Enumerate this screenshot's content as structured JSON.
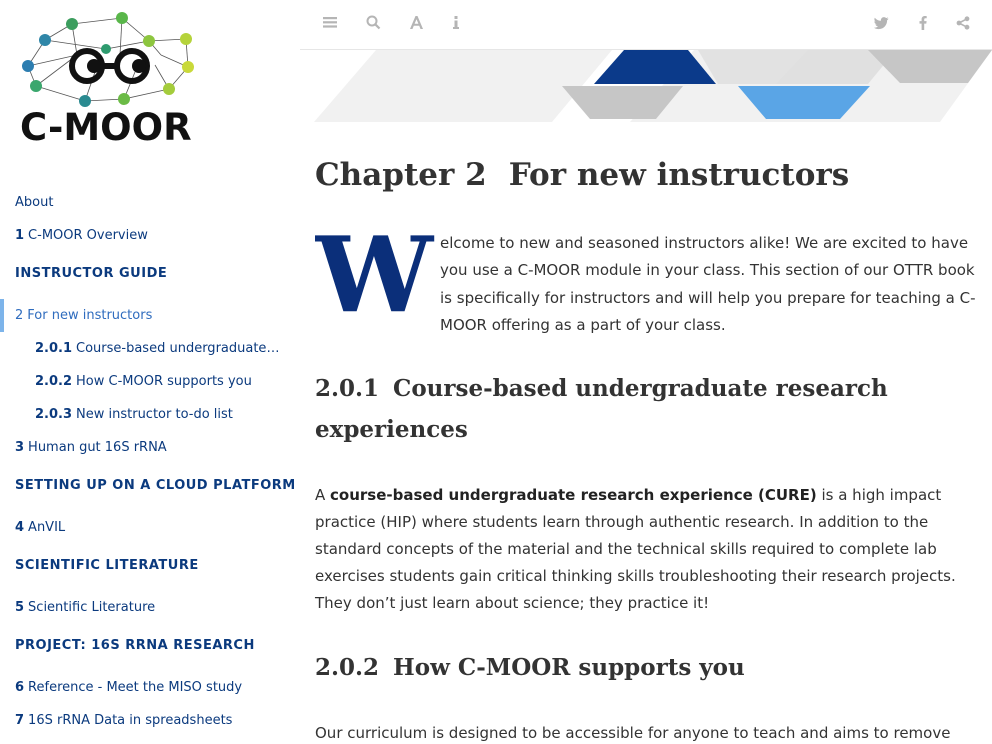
{
  "logo": {
    "text": "C-MOOR"
  },
  "toolbar": {
    "buttons": [
      {
        "name": "toggle-sidebar",
        "icon": "list-icon"
      },
      {
        "name": "search",
        "icon": "search-icon"
      },
      {
        "name": "font-settings",
        "icon": "font-icon"
      },
      {
        "name": "info",
        "icon": "info-icon"
      },
      {
        "name": "twitter",
        "icon": "twitter-icon"
      },
      {
        "name": "facebook",
        "icon": "facebook-icon"
      },
      {
        "name": "share",
        "icon": "share-icon"
      }
    ]
  },
  "sidebar": {
    "about": "About",
    "item1": {
      "num": "1",
      "label": "C-MOOR Overview"
    },
    "header_instructor": "Instructor Guide",
    "item2": {
      "num": "2",
      "label": "For new instructors"
    },
    "item2_0_1": {
      "num": "2.0.1",
      "label": "Course-based undergraduate research experiences"
    },
    "item2_0_2": {
      "num": "2.0.2",
      "label": "How C-MOOR supports you"
    },
    "item2_0_3": {
      "num": "2.0.3",
      "label": "New instructor to-do list"
    },
    "item3": {
      "num": "3",
      "label": "Human gut 16S rRNA"
    },
    "header_cloud": "Setting up on a cloud platform",
    "item4": {
      "num": "4",
      "label": "AnVIL"
    },
    "header_sci": "Scientific Literature",
    "item5": {
      "num": "5",
      "label": "Scientific Literature"
    },
    "header_project": "Project: 16S rRNA Research",
    "item6": {
      "num": "6",
      "label": "Reference - Meet the MISO study"
    },
    "item7": {
      "num": "7",
      "label": "16S rRNA Data in spreadsheets"
    }
  },
  "content": {
    "chapter_num": "Chapter 2",
    "chapter_title": "For new instructors",
    "dropcap_letter": "W",
    "intro": "elcome to new and seasoned instructors alike! We are excited to have you use a C-MOOR module in your class. This section of our OTTR book is specifically for instructors and will help you prepare for teaching a C-MOOR offering as a part of your class.",
    "sec1_num": "2.0.1",
    "sec1_title": "Course-based undergraduate research experiences",
    "sec1_p_pre": "A ",
    "sec1_p_bold": "course-based undergraduate research experience (CURE)",
    "sec1_p_post": " is a high impact practice (HIP) where students learn through authentic research. In addition to the standard concepts of the material and the technical skills required to complete lab exercises students gain critical thinking skills troubleshooting their research projects. They don’t just learn about science; they practice it!",
    "sec2_num": "2.0.2",
    "sec2_title": "How C-MOOR supports you",
    "sec2_p": "Our curriculum is designed to be accessible for anyone to teach and aims to remove many of the barriers that prevent instructors from trying computational biology"
  },
  "colors": {
    "link": "#0b3a7e",
    "active": "#2f6cbe",
    "active_bar": "#7db4ea",
    "banner_navy": "#0b3a8a",
    "banner_blue": "#5aa5e6",
    "banner_grey": "#c8c8c8"
  }
}
